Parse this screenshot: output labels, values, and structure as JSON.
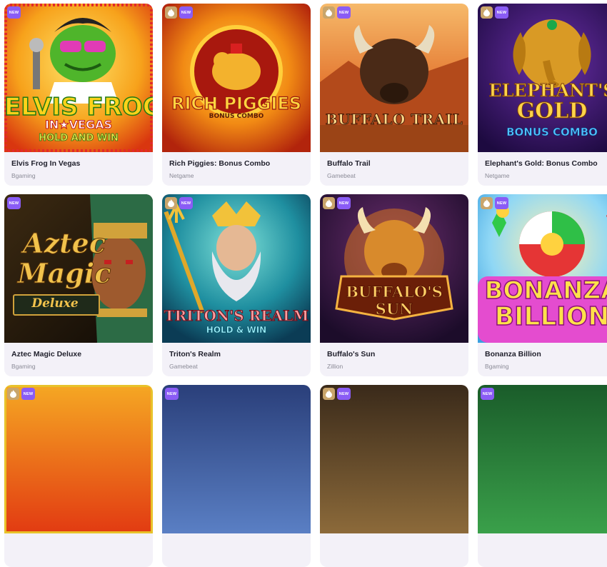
{
  "badges": {
    "new_label": "NEW"
  },
  "games": [
    {
      "title": "Elvis Frog In Vegas",
      "provider": "Bgaming",
      "hot": false,
      "art_text": [
        "ELVIS FROG",
        "IN★VEGAS",
        "HOLD AND WIN"
      ]
    },
    {
      "title": "Rich Piggies: Bonus Combo",
      "provider": "Netgame",
      "hot": true,
      "art_text": [
        "RICH PIGGIES",
        "BONUS COMBO"
      ]
    },
    {
      "title": "Buffalo Trail",
      "provider": "Gamebeat",
      "hot": true,
      "art_text": [
        "BUFFALO TRAIL"
      ]
    },
    {
      "title": "Elephant's Gold: Bonus Combo",
      "provider": "Netgame",
      "hot": true,
      "art_text": [
        "ELEPHANT'S",
        "GOLD",
        "BONUS COMBO"
      ]
    },
    {
      "title": "Aztec Magic Deluxe",
      "provider": "Bgaming",
      "hot": false,
      "art_text": [
        "Aztec",
        "Magic",
        "Deluxe"
      ]
    },
    {
      "title": "Triton's Realm",
      "provider": "Gamebeat",
      "hot": true,
      "art_text": [
        "TRITON'S REALM",
        "HOLD & WIN"
      ]
    },
    {
      "title": "Buffalo's Sun",
      "provider": "Zillion",
      "hot": true,
      "art_text": [
        "BUFFALO'S",
        "SUN"
      ]
    },
    {
      "title": "Bonanza Billion",
      "provider": "Bgaming",
      "hot": true,
      "art_text": [
        "BONANZA",
        "BILLION"
      ]
    },
    {
      "title": "",
      "provider": "",
      "hot": true
    },
    {
      "title": "",
      "provider": "",
      "hot": false
    },
    {
      "title": "",
      "provider": "",
      "hot": true
    },
    {
      "title": "",
      "provider": "",
      "hot": false
    }
  ],
  "colors": {
    "card_bg": "#f3f1f8",
    "new_badge": "#8a5cf5",
    "hot_badge": "#c9a56b"
  }
}
